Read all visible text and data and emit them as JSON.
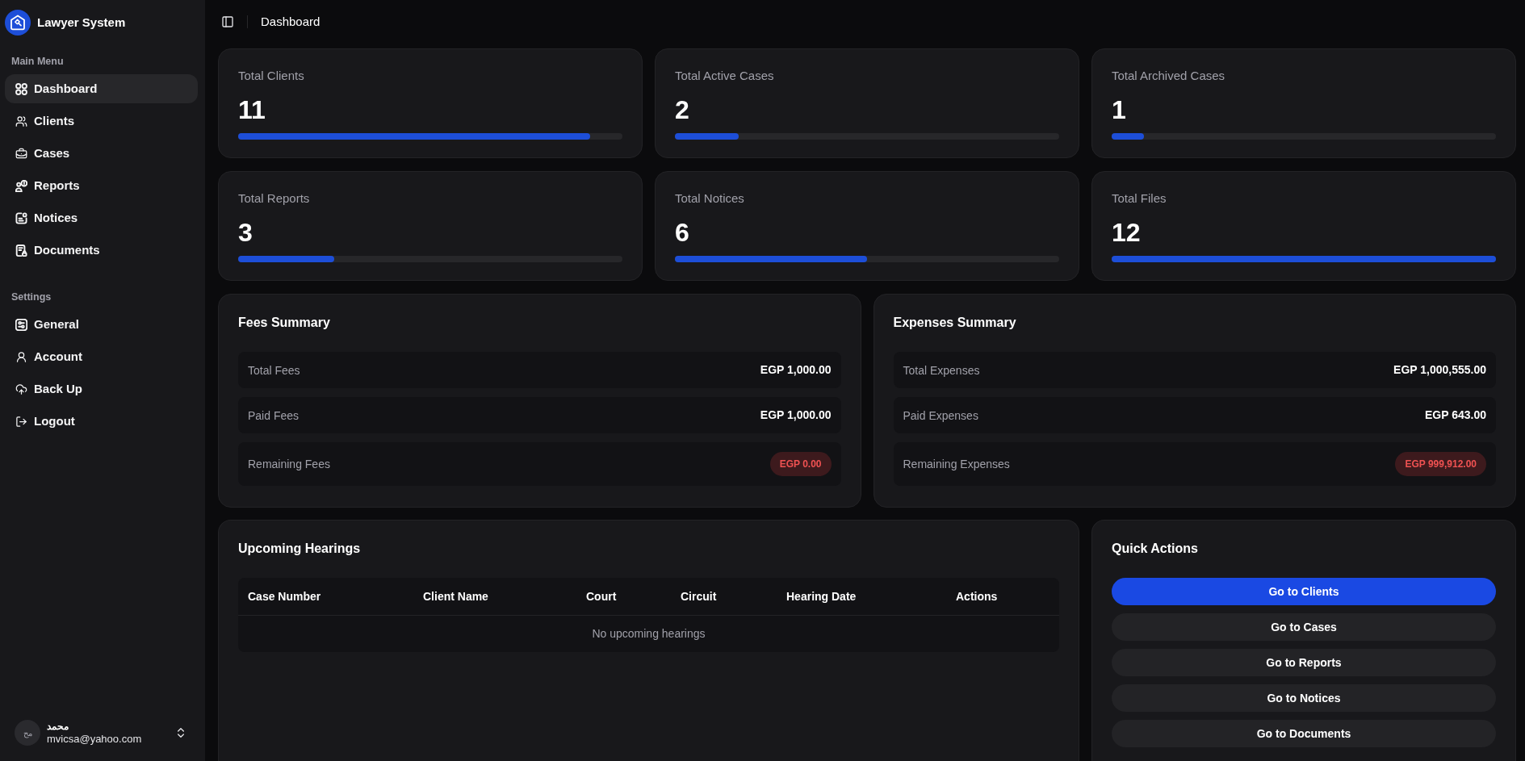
{
  "sidebar": {
    "app_name": "Lawyer System",
    "sections": [
      {
        "title": "Main Menu",
        "items": [
          {
            "label": "Dashboard",
            "selected": true
          },
          {
            "label": "Clients",
            "selected": false
          },
          {
            "label": "Cases",
            "selected": false
          },
          {
            "label": "Reports",
            "selected": false
          },
          {
            "label": "Notices",
            "selected": false
          },
          {
            "label": "Documents",
            "selected": false
          }
        ]
      },
      {
        "title": "Settings",
        "items": [
          {
            "label": "General",
            "selected": false
          },
          {
            "label": "Account",
            "selected": false
          },
          {
            "label": "Back Up",
            "selected": false
          },
          {
            "label": "Logout",
            "selected": false
          }
        ]
      }
    ],
    "user": {
      "initials": "مح",
      "name": "محمد",
      "email": "mvicsa@yahoo.com"
    }
  },
  "header": {
    "title": "Dashboard"
  },
  "stats": [
    {
      "label": "Total Clients",
      "value": "11",
      "level": 0.917
    },
    {
      "label": "Total Active Cases",
      "value": "2",
      "level": 0.167
    },
    {
      "label": "Total Archived Cases",
      "value": "1",
      "level": 0.083
    },
    {
      "label": "Total Reports",
      "value": "3",
      "level": 0.25
    },
    {
      "label": "Total Notices",
      "value": "6",
      "level": 0.5
    },
    {
      "label": "Total Files",
      "value": "12",
      "level": 1
    }
  ],
  "summaries": [
    {
      "title": "Fees Summary",
      "rows": [
        {
          "label": "Total Fees",
          "value": "EGP 1,000.00",
          "kind": "amount"
        },
        {
          "label": "Paid Fees",
          "value": "EGP 1,000.00",
          "kind": "amount"
        },
        {
          "label": "Remaining Fees",
          "value": "EGP 0.00",
          "kind": "badge"
        }
      ]
    },
    {
      "title": "Expenses Summary",
      "rows": [
        {
          "label": "Total Expenses",
          "value": "EGP 1,000,555.00",
          "kind": "amount"
        },
        {
          "label": "Paid Expenses",
          "value": "EGP 643.00",
          "kind": "amount"
        },
        {
          "label": "Remaining Expenses",
          "value": "EGP 999,912.00",
          "kind": "badge"
        }
      ]
    }
  ],
  "upcoming_hearings": {
    "title": "Upcoming Hearings",
    "columns": [
      "Case Number",
      "Client Name",
      "Court",
      "Circuit",
      "Hearing Date",
      "Actions"
    ],
    "empty_message": "No upcoming hearings"
  },
  "quick_actions": {
    "title": "Quick Actions",
    "buttons": [
      {
        "label": "Go to Clients",
        "kind": "primary"
      },
      {
        "label": "Go to Cases",
        "kind": "secondary"
      },
      {
        "label": "Go to Reports",
        "kind": "secondary"
      },
      {
        "label": "Go to Notices",
        "kind": "secondary"
      },
      {
        "label": "Go to Documents",
        "kind": "secondary"
      }
    ]
  }
}
